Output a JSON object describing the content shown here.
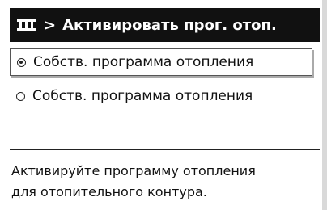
{
  "header": {
    "icon": "radiator-icon",
    "separator": ">",
    "title": "Активировать прог. отоп."
  },
  "options": [
    {
      "label": "Собств. программа отопления",
      "selected": true
    },
    {
      "label": "Собств. программа отопления",
      "selected": false
    }
  ],
  "help": {
    "line1": "Активируйте программу отопления",
    "line2": "для отопительного контура."
  },
  "colors": {
    "title_bg": "#111111",
    "title_fg": "#ffffff",
    "text": "#111111"
  }
}
